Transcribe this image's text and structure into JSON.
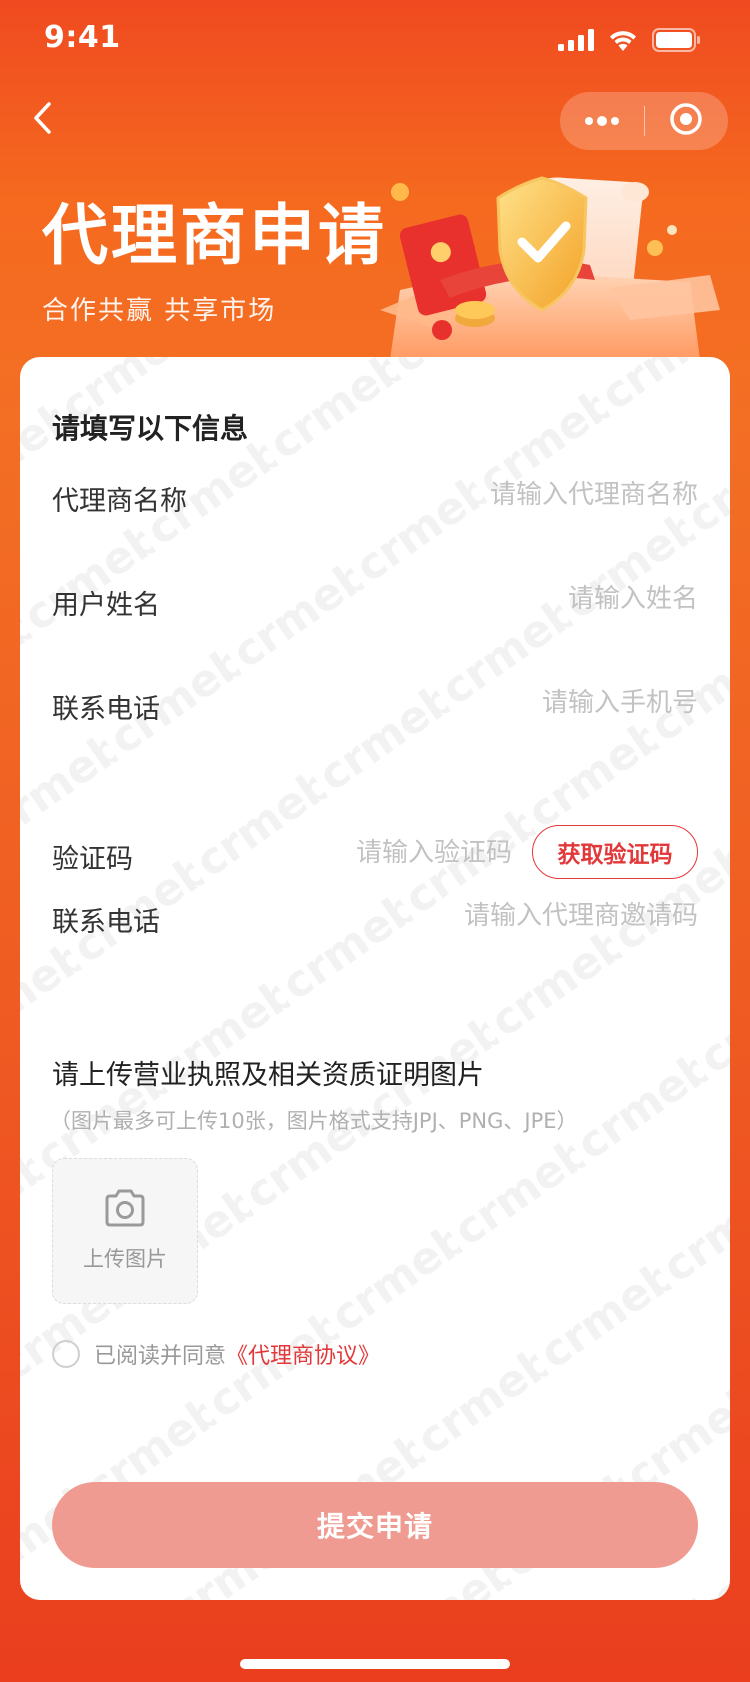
{
  "status_bar": {
    "time": "9:41",
    "icons": [
      "signal-icon",
      "wifi-icon",
      "battery-icon"
    ]
  },
  "nav": {
    "back_icon": "chevron-left-icon",
    "capsule_icons": [
      "more-dots-icon",
      "close-target-icon"
    ]
  },
  "header": {
    "title": "代理商申请",
    "subtitle": "合作共赢 共享市场",
    "illustration_icon": "shield-check-illustration"
  },
  "form": {
    "heading": "请填写以下信息",
    "fields": [
      {
        "label": "代理商名称",
        "placeholder": "请输入代理商名称",
        "value": ""
      },
      {
        "label": "用户姓名",
        "placeholder": "请输入姓名",
        "value": ""
      },
      {
        "label": "联系电话",
        "placeholder": "请输入手机号",
        "value": ""
      },
      {
        "label": "验证码",
        "placeholder": "请输入验证码",
        "value": "",
        "button_label": "获取验证码"
      },
      {
        "label": "联系电话",
        "placeholder": "请输入代理商邀请码",
        "value": ""
      }
    ],
    "upload": {
      "title": "请上传营业执照及相关资质证明图片",
      "hint": "（图片最多可上传10张，图片格式支持JPJ、PNG、JPE）",
      "button_label": "上传图片",
      "icon": "camera-icon"
    },
    "agreement": {
      "checked": false,
      "text": "已阅读并同意",
      "link_text": "《代理商协议》"
    },
    "submit_label": "提交申请"
  },
  "watermark_text": "crmeb",
  "colors": {
    "accent": "#e2383a",
    "header_gradient_top": "#f04a20",
    "header_gradient_bottom": "#ea3e1f",
    "submit_disabled": "#f09b91",
    "placeholder": "#c2c2c2"
  }
}
